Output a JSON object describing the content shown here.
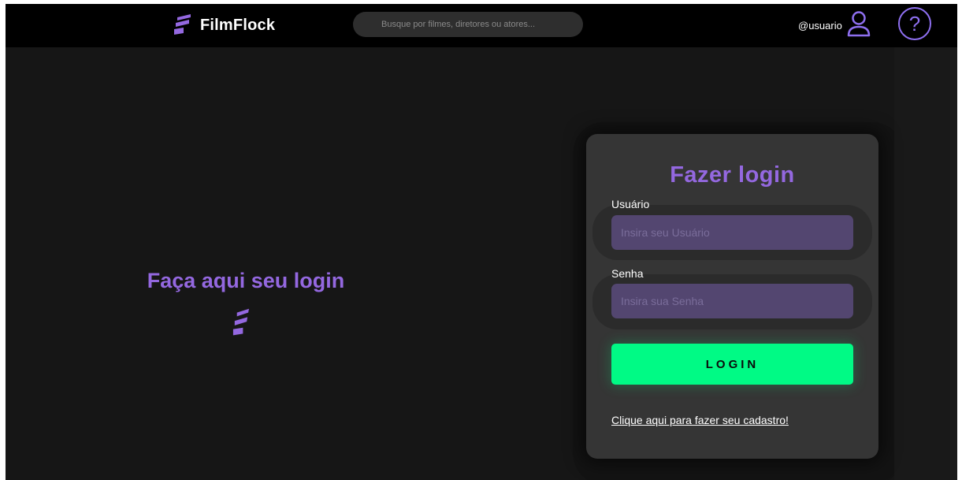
{
  "header": {
    "brand": "FilmFlock",
    "search_placeholder": "Busque por filmes, diretores ou atores...",
    "username": "@usuario",
    "help_symbol": "?"
  },
  "hero": {
    "title": "Faça aqui seu login"
  },
  "login": {
    "title": "Fazer login",
    "username_label": "Usuário",
    "username_placeholder": "Insira seu Usuário",
    "password_label": "Senha",
    "password_placeholder": "Insira sua Senha",
    "submit_label": "LOGIN",
    "signup_link": "Clique aqui para fazer seu cadastro!"
  },
  "icons": {
    "brand": "logo-stripes-icon",
    "user": "user-icon",
    "help": "help-icon"
  },
  "colors": {
    "accent": "#9468e0",
    "button": "#00fa85",
    "input": "#534670",
    "card": "#353535",
    "header": "#000000",
    "background": "#161616"
  }
}
